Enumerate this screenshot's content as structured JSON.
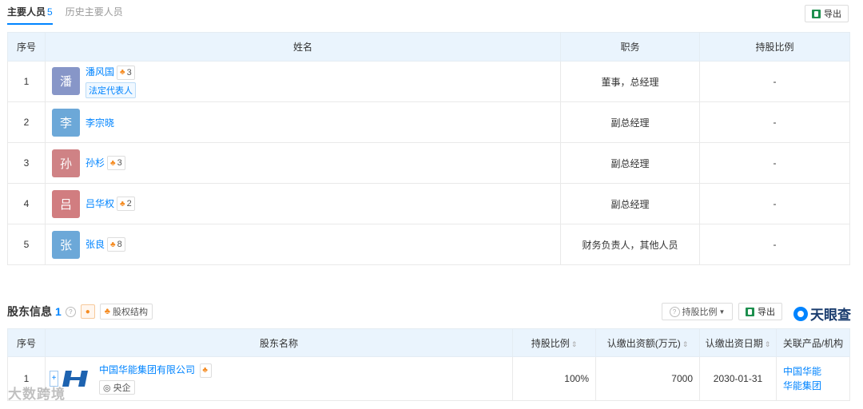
{
  "tabs": [
    {
      "label": "主要人员",
      "count": "5",
      "active": true
    },
    {
      "label": "历史主要人员",
      "active": false
    }
  ],
  "export_label": "导出",
  "staff": {
    "headers": [
      "序号",
      "姓名",
      "职务",
      "持股比例"
    ],
    "rows": [
      {
        "index": "1",
        "avatar": "潘",
        "avatar_color": "#8796c8",
        "name": "潘风国",
        "rel": "3",
        "legal": "法定代表人",
        "position": "董事，总经理",
        "share": "-"
      },
      {
        "index": "2",
        "avatar": "李",
        "avatar_color": "#6ca8d8",
        "name": "李宗晓",
        "rel": "",
        "legal": "",
        "position": "副总经理",
        "share": "-"
      },
      {
        "index": "3",
        "avatar": "孙",
        "avatar_color": "#cf8285",
        "name": "孙杉",
        "rel": "3",
        "legal": "",
        "position": "副总经理",
        "share": "-"
      },
      {
        "index": "4",
        "avatar": "吕",
        "avatar_color": "#d17d80",
        "name": "吕华权",
        "rel": "2",
        "legal": "",
        "position": "副总经理",
        "share": "-"
      },
      {
        "index": "5",
        "avatar": "张",
        "avatar_color": "#6ca8d8",
        "name": "张良",
        "rel": "8",
        "legal": "",
        "position": "财务负责人，其他人员",
        "share": "-"
      }
    ]
  },
  "shareholders": {
    "title": "股东信息",
    "count": "1",
    "equity_btn": "股权结构",
    "ratio_filter": "持股比例",
    "export_label": "导出",
    "logo_text": "天眼查",
    "headers": [
      "序号",
      "股东名称",
      "持股比例",
      "认缴出资额(万元)",
      "认缴出资日期",
      "关联产品/机构"
    ],
    "rows": [
      {
        "index": "1",
        "name": "中国华能集团有限公司",
        "tag": "央企",
        "ratio": "100%",
        "amount": "7000",
        "date": "2030-01-31",
        "related_1": "中国华能",
        "related_2": "华能集团"
      }
    ]
  },
  "watermark": "大数跨境"
}
